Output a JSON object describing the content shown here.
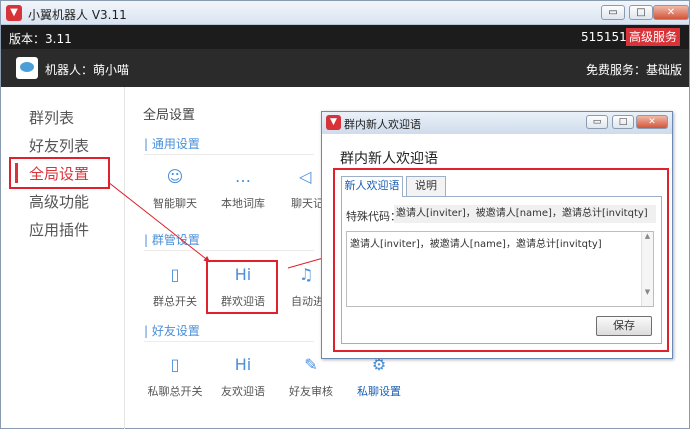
{
  "window": {
    "title": "小翼机器人 V3.11",
    "logo_glyph": "▼",
    "controls": {
      "minimize": "▭",
      "maximize": "□",
      "close": "✕"
    }
  },
  "version_bar": {
    "version": "版本：3.11",
    "account_id": "515151",
    "premium_label": "高级服务"
  },
  "robot_bar": {
    "robot_label": "机器人：萌小喵",
    "service_label": "免费服务：基础版"
  },
  "sidebar": {
    "items": [
      {
        "label": "群列表"
      },
      {
        "label": "好友列表"
      },
      {
        "label": "全局设置"
      },
      {
        "label": "高级功能"
      },
      {
        "label": "应用插件"
      }
    ]
  },
  "content": {
    "title": "全局设置",
    "sections": [
      {
        "title": "| 通用设置",
        "features": [
          {
            "label": "智能聊天",
            "icon": "robot-head-icon",
            "glyph": "☺"
          },
          {
            "label": "本地词库",
            "icon": "speech-bubble-icon",
            "glyph": "…"
          },
          {
            "label": "聊天记",
            "icon": "speaker-icon",
            "glyph": "◁"
          }
        ]
      },
      {
        "title": "| 群管设置",
        "features": [
          {
            "label": "群总开关",
            "icon": "phone-toggle-icon",
            "glyph": "▯"
          },
          {
            "label": "群欢迎语",
            "icon": "hi-icon",
            "glyph": "Hi"
          },
          {
            "label": "自动进",
            "icon": "bell-icon",
            "glyph": "♫"
          }
        ]
      },
      {
        "title": "| 好友设置",
        "features": [
          {
            "label": "私聊总开关",
            "icon": "phone-toggle-icon",
            "glyph": "▯"
          },
          {
            "label": "友欢迎语",
            "icon": "hi-icon",
            "glyph": "Hi"
          },
          {
            "label": "好友审核",
            "icon": "document-edit-icon",
            "glyph": "✎"
          },
          {
            "label": "私聊设置",
            "icon": "gear-icon",
            "glyph": "⚙"
          }
        ]
      }
    ]
  },
  "dialog": {
    "title": "群内新人欢迎语",
    "heading": "群内新人欢迎语",
    "tabs": [
      {
        "label": "新人欢迎语"
      },
      {
        "label": "说明"
      }
    ],
    "special_code_label": "特殊代码：",
    "special_code_value": "邀请人[inviter]，被邀请人[name]，邀请总计[invitqty]",
    "message_text": "邀请人[inviter]，被邀请人[name]，邀请总计[invitqty]",
    "save_label": "保存"
  },
  "colors": {
    "accent_red": "#d9333a",
    "link_blue": "#4a90d9",
    "highlight_box": "#e0202a"
  }
}
